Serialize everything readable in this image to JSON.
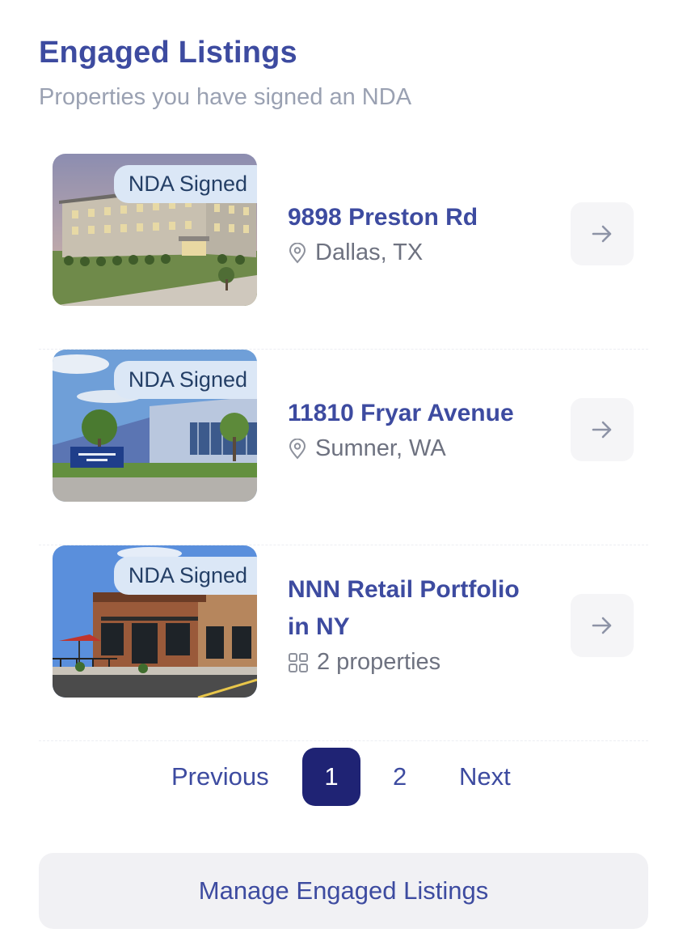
{
  "header": {
    "title": "Engaged Listings",
    "subtitle": "Properties you have signed an NDA"
  },
  "listings": [
    {
      "badge": "NDA Signed",
      "name_line1": "9898 Preston Rd",
      "name_line2": "",
      "meta": "Dallas, TX",
      "meta_icon": "location-pin-icon"
    },
    {
      "badge": "NDA Signed",
      "name_line1": "11810 Fryar Avenue",
      "name_line2": "",
      "meta": "Sumner, WA",
      "meta_icon": "location-pin-icon"
    },
    {
      "badge": "NDA Signed",
      "name_line1": "NNN Retail Portfolio",
      "name_line2": "in NY",
      "meta": "2 properties",
      "meta_icon": "grid-icon"
    }
  ],
  "pagination": {
    "previous": "Previous",
    "pages": [
      "1",
      "2"
    ],
    "current": "1",
    "next": "Next"
  },
  "footer": {
    "manage_label": "Manage Engaged Listings"
  },
  "colors": {
    "primary_text": "#3d4ba0",
    "active_page": "#1f2374",
    "badge_bg": "#dbe7f6"
  }
}
